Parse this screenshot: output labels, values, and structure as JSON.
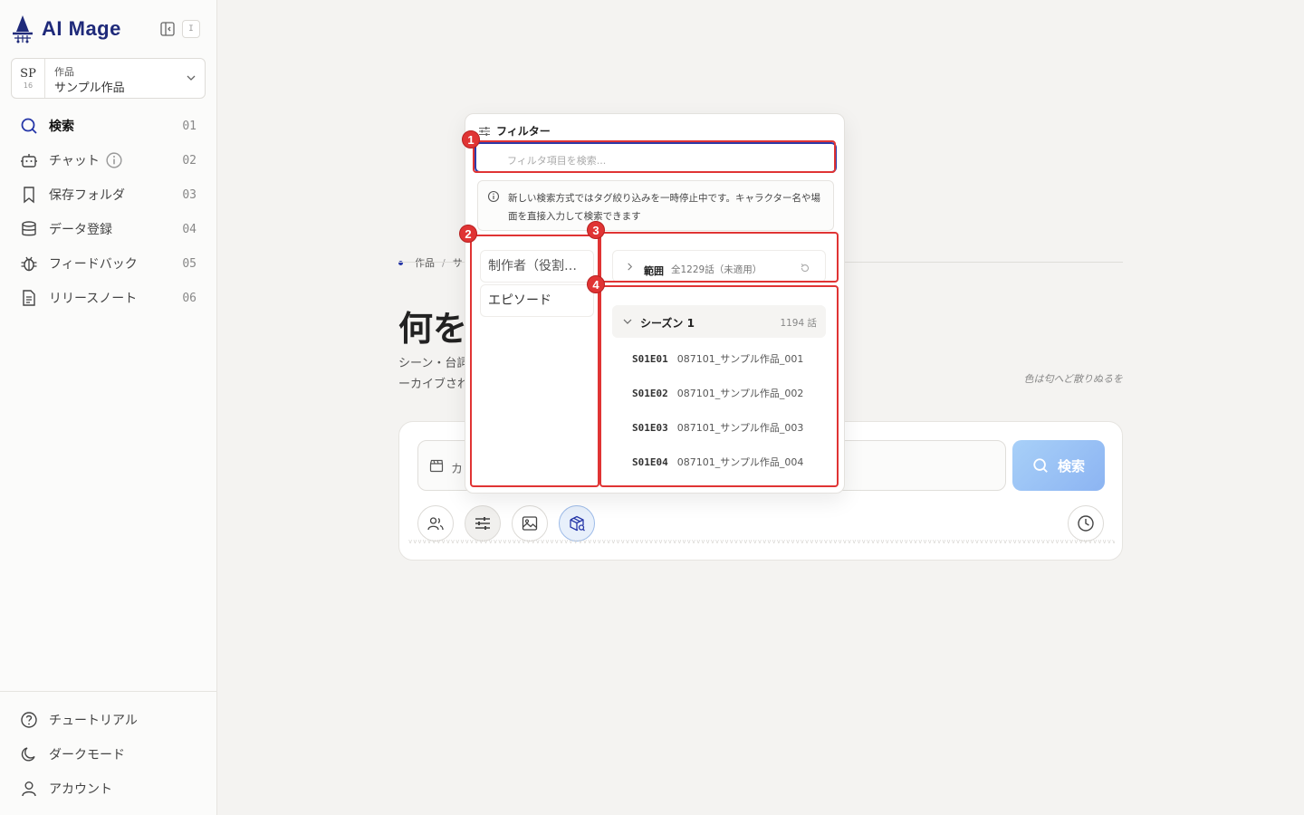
{
  "app": {
    "logo_text": "AI Mage",
    "box_glyph": "I"
  },
  "project": {
    "code": "SP",
    "code_num": "16",
    "label": "作品",
    "name": "サンプル作品"
  },
  "nav": {
    "items": [
      {
        "label": "検索",
        "num": "01"
      },
      {
        "label": "チャット",
        "num": "02"
      },
      {
        "label": "保存フォルダ",
        "num": "03"
      },
      {
        "label": "データ登録",
        "num": "04"
      },
      {
        "label": "フィードバック",
        "num": "05"
      },
      {
        "label": "リリースノート",
        "num": "06"
      }
    ]
  },
  "bottom_nav": {
    "items": [
      {
        "label": "チュートリアル"
      },
      {
        "label": "ダークモード"
      },
      {
        "label": "アカウント"
      }
    ]
  },
  "main": {
    "breadcrumb": [
      "作品",
      "サ"
    ],
    "hero_title": "何を",
    "hero_sub_line1": "シーン・台詞",
    "hero_sub_line2": "ーカイブされ",
    "hero_quote": "色は匂へど散りぬるを",
    "search_placeholder": "カ",
    "search_button": "検索"
  },
  "filter": {
    "title": "フィルター",
    "search_placeholder": "フィルタ項目を検索...",
    "notice": "新しい検索方式ではタグ絞り込みを一時停止中です。キャラクター名や場面を直接入力して検索できます",
    "categories": [
      "制作者（役割…",
      "エピソード"
    ],
    "range_label": "範囲",
    "range_value": "全1229話（未適用）",
    "season_label": "シーズン 1",
    "season_count": "1194 話",
    "episodes": [
      {
        "code": "S01E01",
        "title": "087101_サンプル作品_001"
      },
      {
        "code": "S01E02",
        "title": "087101_サンプル作品_002"
      },
      {
        "code": "S01E03",
        "title": "087101_サンプル作品_003"
      },
      {
        "code": "S01E04",
        "title": "087101_サンプル作品_004"
      }
    ]
  },
  "markers": [
    "1",
    "2",
    "3",
    "4"
  ],
  "colors": {
    "brand": "#1f2a7a",
    "accent": "#2f3aa8",
    "highlight": "#e03434",
    "search_button": "#8cb4f2"
  },
  "icons": {
    "nav": [
      "search-icon",
      "robot-icon",
      "bookmark-icon",
      "database-icon",
      "bug-icon",
      "document-icon"
    ],
    "bottom": [
      "help-icon",
      "moon-icon",
      "user-icon"
    ],
    "tools": [
      "people-icon",
      "sliders-icon",
      "image-icon",
      "package-search-icon",
      "clock-icon"
    ]
  }
}
